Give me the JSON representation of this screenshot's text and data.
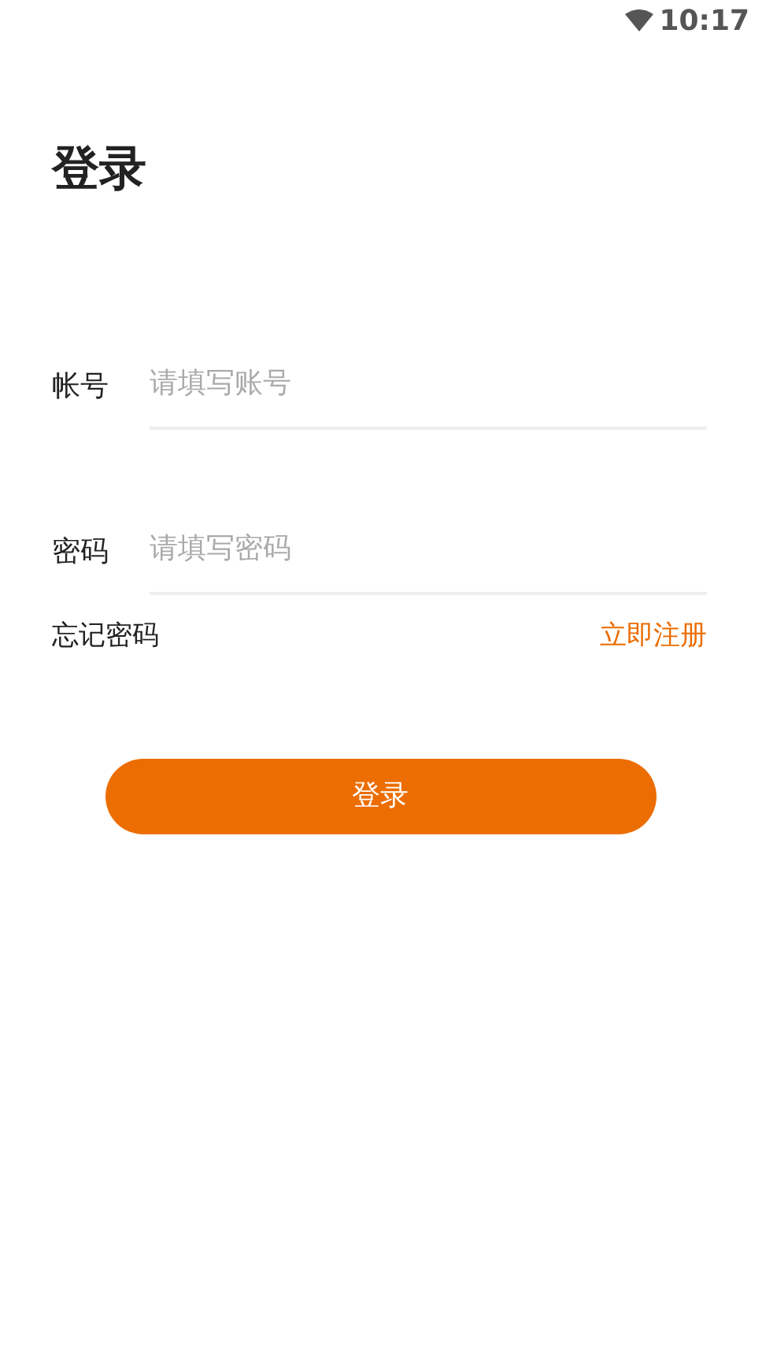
{
  "status_bar": {
    "time": "10:17"
  },
  "title": "登录",
  "fields": [
    {
      "label": "帐号",
      "placeholder": "请填写账号"
    },
    {
      "label": "密码",
      "placeholder": "请填写密码"
    }
  ],
  "forgot_link": "忘记密码",
  "register_link": "立即注册",
  "login_button": "登录"
}
